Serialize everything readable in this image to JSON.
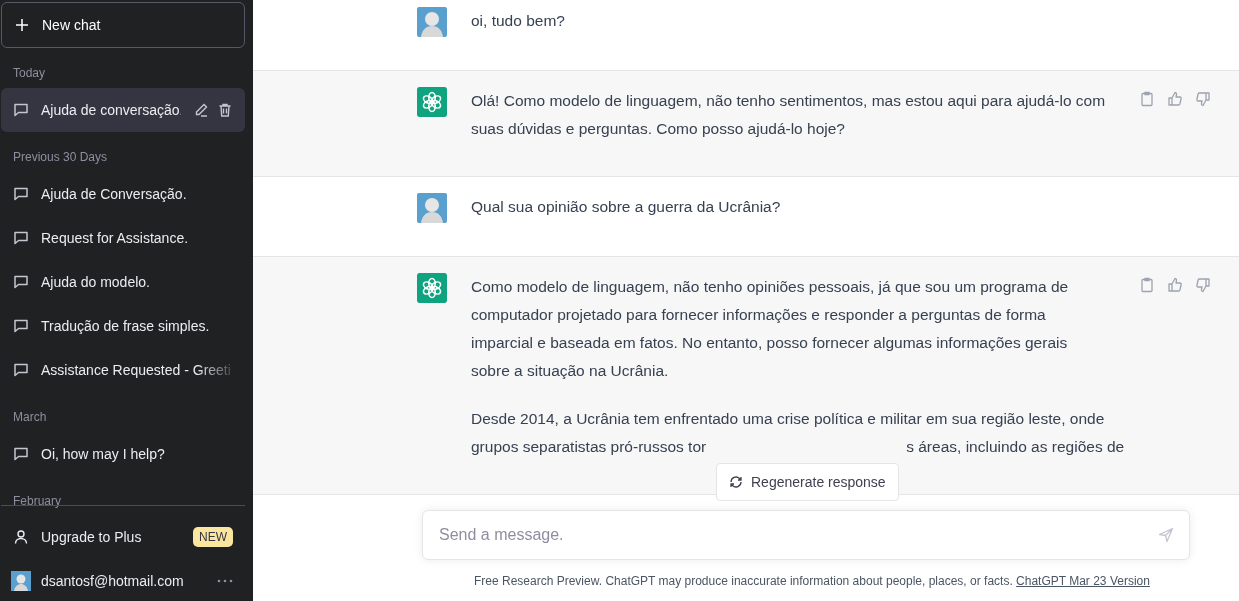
{
  "sidebar": {
    "new_chat": "New chat",
    "sections": [
      {
        "title": "Today",
        "items": [
          {
            "title": "Ajuda de conversação.",
            "selected": true,
            "faded": false
          }
        ]
      },
      {
        "title": "Previous 30 Days",
        "items": [
          {
            "title": "Ajuda de Conversação.",
            "selected": false,
            "faded": false
          },
          {
            "title": "Request for Assistance.",
            "selected": false,
            "faded": false
          },
          {
            "title": "Ajuda do modelo.",
            "selected": false,
            "faded": false
          },
          {
            "title": "Tradução de frase simples.",
            "selected": false,
            "faded": false
          },
          {
            "title": "Assistance Requested - Greeti",
            "selected": false,
            "faded": true
          }
        ]
      },
      {
        "title": "March",
        "items": [
          {
            "title": "Oi, how may I help?",
            "selected": false,
            "faded": false
          }
        ]
      },
      {
        "title": "February"
      }
    ],
    "upgrade": {
      "label": "Upgrade to Plus",
      "badge": "NEW"
    },
    "account": {
      "email": "dsantosf@hotmail.com"
    }
  },
  "messages": [
    {
      "kind": "user",
      "paragraphs": [
        [
          [
            "oi, tudo bem?"
          ]
        ]
      ]
    },
    {
      "kind": "assistant",
      "paragraphs": [
        [
          [
            "Olá! Como modelo de linguagem, não tenho sentimentos, mas estou aqui para ajudá-lo com"
          ],
          [
            "suas dúvidas e perguntas. Como posso ajudá-lo hoje?"
          ]
        ]
      ]
    },
    {
      "kind": "user",
      "paragraphs": [
        [
          [
            "Qual sua opinião sobre a guerra da Ucrânia?"
          ]
        ]
      ]
    },
    {
      "kind": "assistant",
      "paragraphs": [
        [
          [
            "Como modelo de linguagem, não tenho opiniões pessoais, já que sou um programa de"
          ],
          [
            "computador projetado para fornecer informações e responder a perguntas de forma"
          ],
          [
            "imparcial e baseada em fatos. No entanto, posso fornecer algumas informações gerais"
          ],
          [
            "sobre a situação na Ucrânia."
          ]
        ],
        [
          [
            "Desde 2014, a Ucrânia tem enfrentado uma crise política e militar em sua região leste, onde"
          ],
          [
            "grupos separatistas pró-russos tor",
            "s áreas, incluindo as regiões de"
          ]
        ]
      ]
    }
  ],
  "regenerate_button": "Regenerate response",
  "composer": {
    "placeholder": "Send a message."
  },
  "footer": {
    "text": "Free Research Preview. ChatGPT may produce inaccurate information about people, places, or facts.",
    "link": "ChatGPT Mar 23 Version"
  }
}
